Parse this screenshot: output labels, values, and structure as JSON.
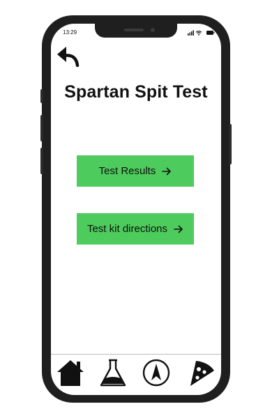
{
  "status_bar": {
    "time": "13:29",
    "icons": [
      "signal-icon",
      "wifi-icon",
      "battery-icon"
    ]
  },
  "header": {
    "back_icon": "back-arrow-icon",
    "title": "Spartan Spit Test"
  },
  "main": {
    "buttons": [
      {
        "label": "Test Results",
        "icon": "arrow-right-icon"
      },
      {
        "label": "Test kit directions",
        "icon": "arrow-right-icon"
      }
    ],
    "button_color": "#4dcb5c"
  },
  "bottom_nav": {
    "items": [
      {
        "icon": "home-icon"
      },
      {
        "icon": "flask-icon"
      },
      {
        "icon": "compass-icon"
      },
      {
        "icon": "pizza-icon"
      }
    ]
  },
  "colors": {
    "phone_frame": "#1f1f1f",
    "screen_background": "#ffffff",
    "text": "#111111"
  }
}
